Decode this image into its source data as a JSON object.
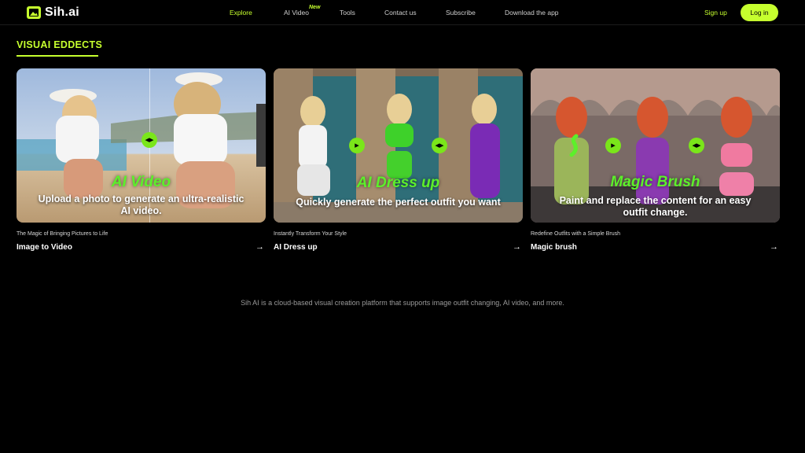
{
  "header": {
    "brand": "Sih.ai",
    "logo_icon": "picture-icon",
    "nav": [
      {
        "label": "Explore",
        "active": true
      },
      {
        "label": "AI Video",
        "badge": "New"
      },
      {
        "label": "Tools"
      },
      {
        "label": "Contact us"
      },
      {
        "label": "Subscribe"
      },
      {
        "label": "Download the app"
      }
    ],
    "signup": "Sign up",
    "login": "Log in"
  },
  "section": {
    "title": "VISUAI EDDECTS"
  },
  "cards": [
    {
      "overlay_title": "AI Video",
      "overlay_desc": "Upload a photo to generate an ultra-realistic AI video.",
      "subtitle": "The Magic of Bringing Pictures to Life",
      "name": "Image to Video"
    },
    {
      "overlay_title": "AI Dress up",
      "overlay_desc": "Quickly generate the perfect outfit you want",
      "subtitle": "Instantly Transform Your Style",
      "name": "AI Dress up"
    },
    {
      "overlay_title": "Magic Brush",
      "overlay_desc": "Paint and replace the content for an easy outfit change.",
      "subtitle": "Redefine Outfits with a Simple Brush",
      "name": "Magic brush"
    }
  ],
  "footer": {
    "text": "Sih AI is a cloud-based visual creation platform that supports image outfit changing, AI video, and more."
  },
  "colors": {
    "accent": "#c6ff2e",
    "background": "#000000",
    "arrow_badge": "#7ae61a"
  }
}
